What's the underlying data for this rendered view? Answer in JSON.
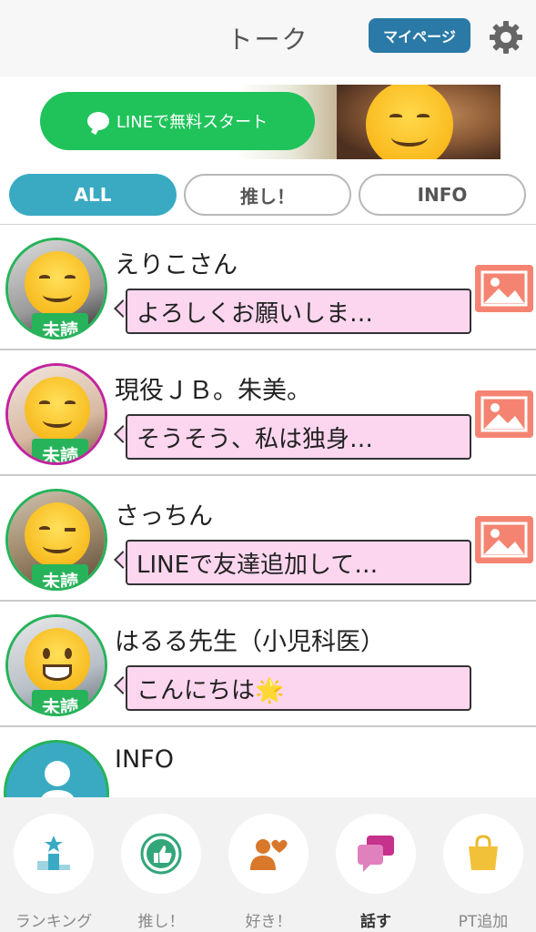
{
  "header": {
    "title": "トーク",
    "mypage_label": "マイページ",
    "gear_icon": "gear-icon"
  },
  "banner": {
    "cta_label": "LINEで無料スタート",
    "line_brand_color": "#1fc35a"
  },
  "tabs": [
    {
      "label": "ALL",
      "selected": true
    },
    {
      "label": "推し！",
      "selected": false
    },
    {
      "label": "INFO",
      "selected": false
    }
  ],
  "chats": [
    {
      "name": "えりこさん",
      "message": "よろしくお願いしま…",
      "badge": "未読",
      "has_photo": true
    },
    {
      "name": "現役ＪＢ。朱美。",
      "message": "そうそう、私は独身…",
      "badge": "未読",
      "has_photo": true
    },
    {
      "name": "さっちん",
      "message": "LINEで友達追加して…",
      "badge": "未読",
      "has_photo": true
    },
    {
      "name": "はるる先生（小児科医）",
      "message": "こんにちは🌟",
      "badge": "未読",
      "has_photo": false
    },
    {
      "name": "INFO",
      "message": "",
      "badge": "",
      "has_photo": false
    }
  ],
  "bottom_nav": [
    {
      "label": "ランキング",
      "icon": "ranking-podium-icon",
      "active": false
    },
    {
      "label": "推し！",
      "icon": "thumbs-up-icon",
      "active": false
    },
    {
      "label": "好き！",
      "icon": "people-heart-icon",
      "active": false
    },
    {
      "label": "話す",
      "icon": "chat-bubbles-icon",
      "active": true
    },
    {
      "label": "PT追加",
      "icon": "shopping-bag-icon",
      "active": false
    }
  ],
  "colors": {
    "accent": "#3aaac3",
    "unread_badge": "#27b35a",
    "bubble": "#fcd6ef",
    "mypage": "#2a79a6",
    "photo_icon": "#f48471"
  }
}
